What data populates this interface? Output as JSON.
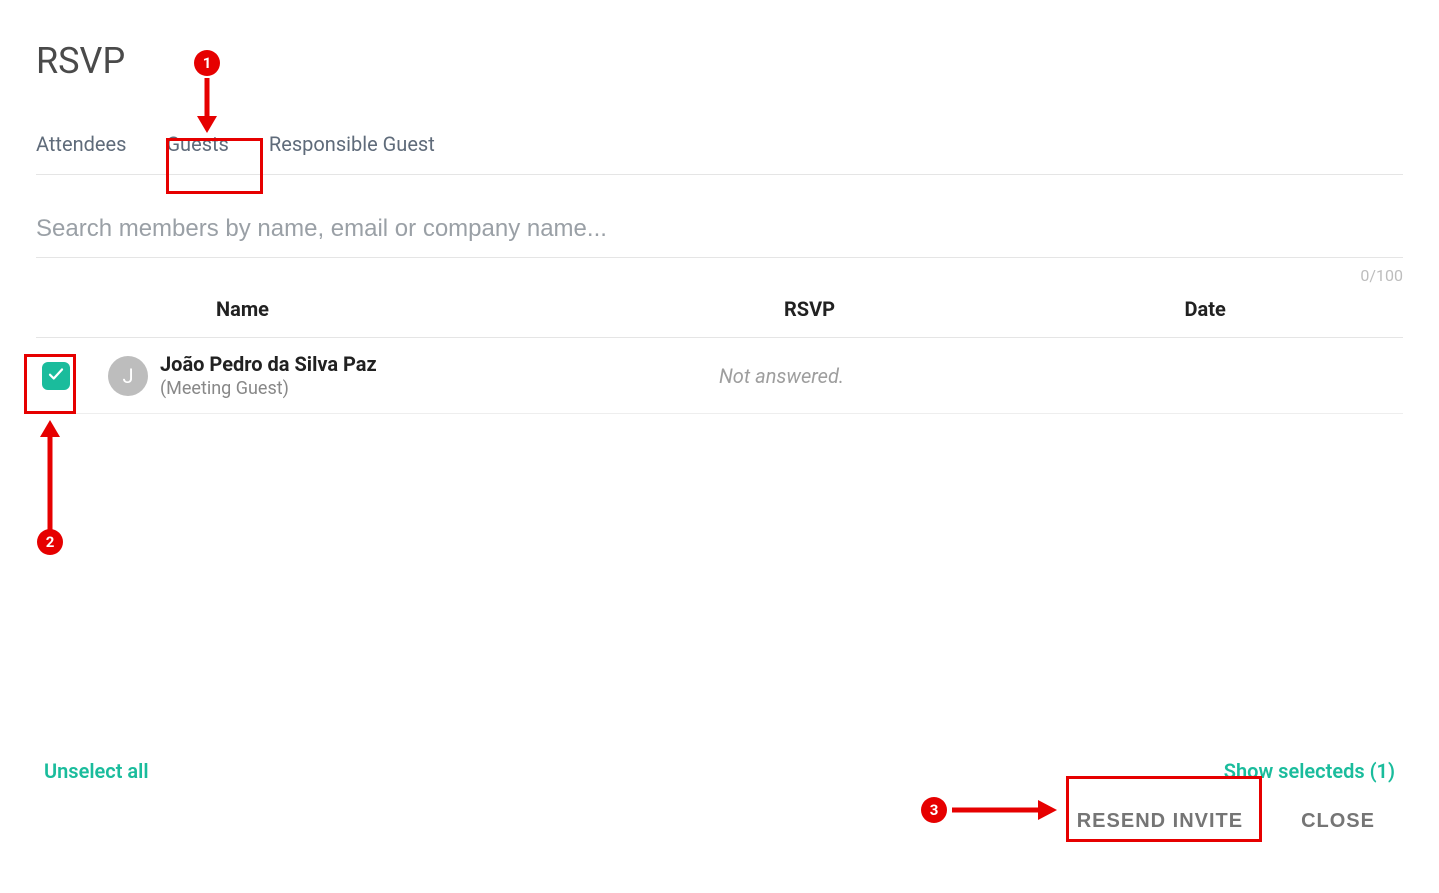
{
  "dialog": {
    "title": "RSVP"
  },
  "tabs": {
    "attendees": "Attendees",
    "guests": "Guests",
    "responsible_guest": "Responsible Guest"
  },
  "search": {
    "placeholder": "Search members by name, email or company name..."
  },
  "counter": "0/100",
  "table": {
    "headers": {
      "name": "Name",
      "rsvp": "RSVP",
      "date": "Date"
    },
    "rows": [
      {
        "avatar_initial": "J",
        "name": "João Pedro da Silva Paz",
        "subtitle": "(Meeting Guest)",
        "rsvp": "Not answered.",
        "date": ""
      }
    ]
  },
  "links": {
    "unselect_all": "Unselect all",
    "show_selected": "Show selecteds (1)"
  },
  "buttons": {
    "resend_invite": "RESEND INVITE",
    "close": "CLOSE"
  },
  "annotations": {
    "one": "1",
    "two": "2",
    "three": "3"
  }
}
